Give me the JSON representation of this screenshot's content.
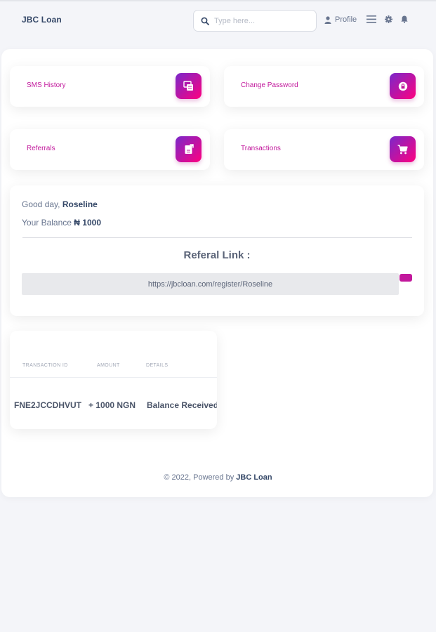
{
  "navbar": {
    "brand": "JBC Loan",
    "search_placeholder": "Type here...",
    "profile_label": "Profile",
    "icons": [
      "menu-icon",
      "gear-icon",
      "bell-icon"
    ]
  },
  "colors": {
    "accent": "#c2189c",
    "gradient_start": "#7928ca",
    "gradient_end": "#ff0080"
  },
  "cards": [
    {
      "label": "SMS History",
      "icon": "sms-history-icon"
    },
    {
      "label": "Change Password",
      "icon": "lock-icon"
    },
    {
      "label": "Referrals",
      "icon": "referrals-icon"
    },
    {
      "label": "Transactions",
      "icon": "cart-icon"
    }
  ],
  "welcome": {
    "greeting_prefix": "Good day,",
    "user_name": "Roseline",
    "balance_prefix": "Your Balance",
    "balance_value": "₦ 1000",
    "referral_title": "Referal Link :",
    "referral_link": "https://jbcloan.com/register/Roseline"
  },
  "transactions": {
    "columns": [
      "TRANSACTION ID",
      "AMOUNT",
      "DETAILS"
    ],
    "rows": [
      {
        "id": "FNE2JCCDHVUT",
        "amount": "+ 1000 NGN",
        "details": "Balance Received"
      }
    ]
  },
  "footer": {
    "prefix": "© 2022, Powered by",
    "brand": "JBC Loan"
  }
}
